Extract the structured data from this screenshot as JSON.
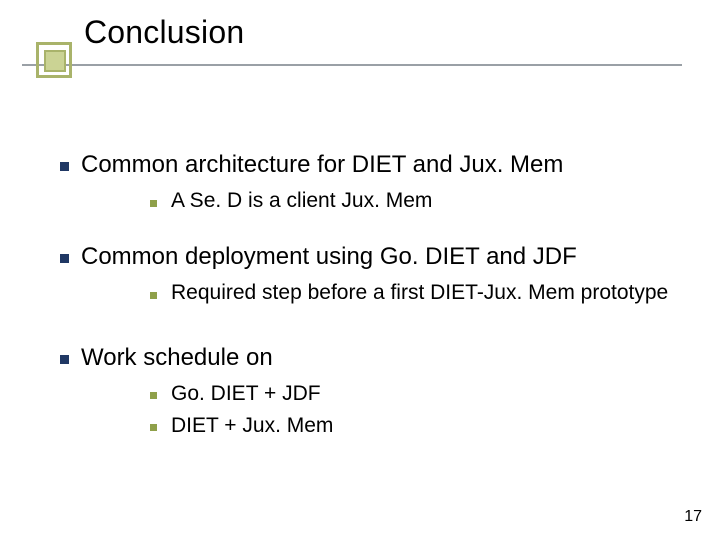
{
  "slide": {
    "title": "Conclusion",
    "page_number": "17",
    "bullets": [
      {
        "text": "Common architecture for DIET and Jux. Mem",
        "children": [
          {
            "text": "A Se. D is a client Jux. Mem"
          }
        ]
      },
      {
        "text": "Common deployment using Go. DIET and JDF",
        "children": [
          {
            "text": "Required step before a first DIET-Jux. Mem prototype"
          }
        ]
      },
      {
        "text": "Work schedule on",
        "children": [
          {
            "text": "Go. DIET + JDF"
          },
          {
            "text": "DIET + Jux. Mem"
          }
        ]
      }
    ]
  }
}
